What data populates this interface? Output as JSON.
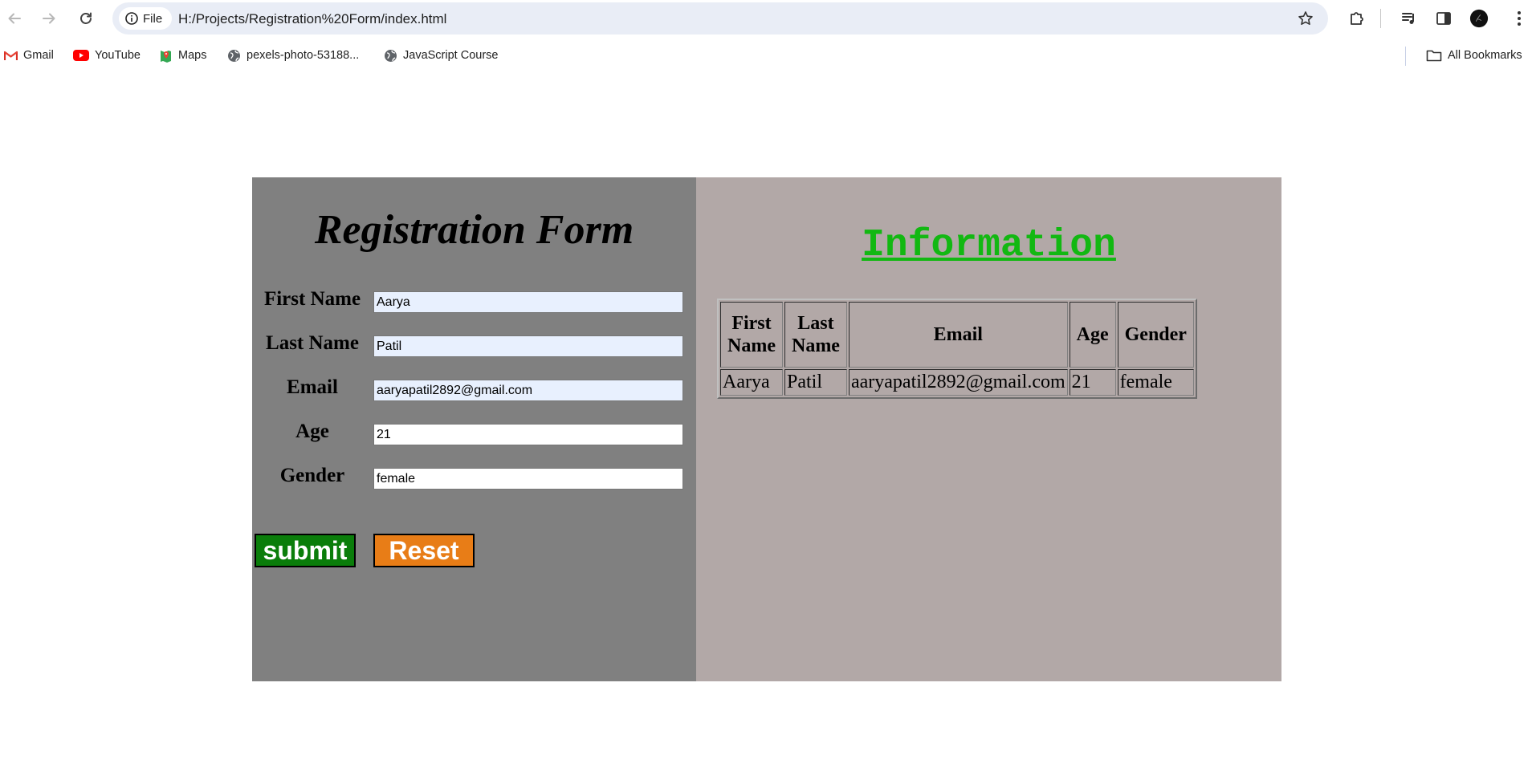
{
  "browser": {
    "site_chip_label": "File",
    "url": "H:/Projects/Registration%20Form/index.html",
    "bookmarks": [
      {
        "label": "Gmail"
      },
      {
        "label": "YouTube"
      },
      {
        "label": "Maps"
      },
      {
        "label": "pexels-photo-53188..."
      },
      {
        "label": "JavaScript Course"
      }
    ],
    "all_bookmarks_label": "All Bookmarks"
  },
  "form": {
    "title": "Registration Form",
    "fields": [
      {
        "label": "First Name",
        "value": "Aarya"
      },
      {
        "label": "Last Name",
        "value": "Patil"
      },
      {
        "label": "Email",
        "value": "aaryapatil2892@gmail.com"
      },
      {
        "label": "Age",
        "value": "21"
      },
      {
        "label": "Gender",
        "value": "female"
      }
    ],
    "submit_label": "submit",
    "reset_label": "Reset"
  },
  "info": {
    "title": "Information",
    "headers": [
      "First\nName",
      "Last\nName",
      "Email",
      "Age",
      "Gender"
    ],
    "rows": [
      [
        "Aarya",
        "Patil",
        "aaryapatil2892@gmail.com",
        "21",
        "female"
      ]
    ]
  },
  "colors": {
    "left_panel": "#808080",
    "right_panel": "#b2a8a7",
    "submit": "#0a7d0a",
    "reset": "#e87d17",
    "info_title": "#12b812"
  }
}
